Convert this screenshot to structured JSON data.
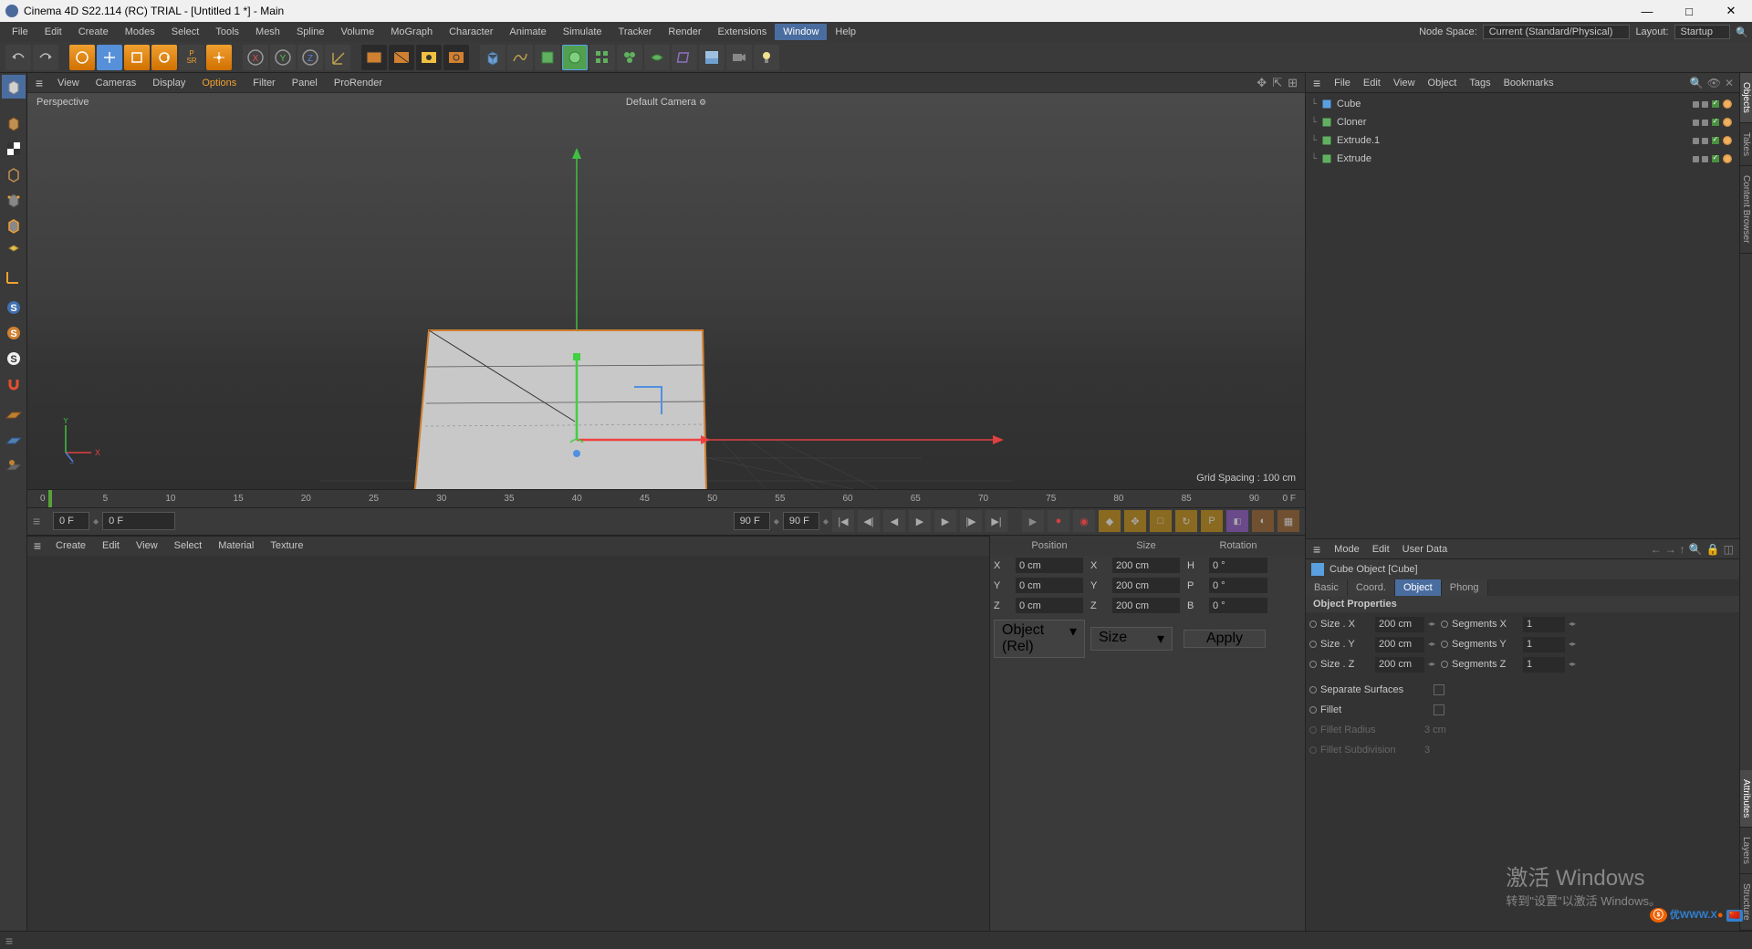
{
  "window": {
    "title": "Cinema 4D S22.114 (RC) TRIAL - [Untitled 1 *] - Main"
  },
  "mainmenu": {
    "items": [
      "File",
      "Edit",
      "Create",
      "Modes",
      "Select",
      "Tools",
      "Mesh",
      "Spline",
      "Volume",
      "MoGraph",
      "Character",
      "Animate",
      "Simulate",
      "Tracker",
      "Render",
      "Extensions",
      "Window",
      "Help"
    ],
    "highlighted": "Window",
    "nodespace_label": "Node Space:",
    "nodespace_value": "Current (Standard/Physical)",
    "layout_label": "Layout:",
    "layout_value": "Startup"
  },
  "viewmenu": {
    "items": [
      "View",
      "Cameras",
      "Display",
      "Options",
      "Filter",
      "Panel",
      "ProRender"
    ],
    "highlighted": "Options"
  },
  "viewport": {
    "label": "Perspective",
    "camera": "Default Camera",
    "grid": "Grid Spacing : 100 cm",
    "axes": {
      "x": "X",
      "y": "Y",
      "z": "Z"
    }
  },
  "timeline": {
    "start": 0,
    "end": 90,
    "ticks": [
      0,
      5,
      10,
      15,
      20,
      25,
      30,
      35,
      40,
      45,
      50,
      55,
      60,
      65,
      70,
      75,
      80,
      85,
      90
    ],
    "unit": "0 F"
  },
  "timecontrols": {
    "frame1": "0 F",
    "frame2": "0 F",
    "frame3": "90 F",
    "frame4": "90 F"
  },
  "matmenu": {
    "items": [
      "Create",
      "Edit",
      "View",
      "Select",
      "Material",
      "Texture"
    ]
  },
  "objmgr": {
    "menu": [
      "File",
      "Edit",
      "View",
      "Object",
      "Tags",
      "Bookmarks"
    ],
    "items": [
      {
        "name": "Cube",
        "icon": "cube",
        "color": "#5aa0e0"
      },
      {
        "name": "Cloner",
        "icon": "cloner",
        "color": "#60b060"
      },
      {
        "name": "Extrude.1",
        "icon": "extrude",
        "color": "#60b060"
      },
      {
        "name": "Extrude",
        "icon": "extrude",
        "color": "#60b060"
      }
    ]
  },
  "attrmgr": {
    "menu": [
      "Mode",
      "Edit",
      "User Data"
    ],
    "title": "Cube Object [Cube]",
    "tabs": [
      "Basic",
      "Coord.",
      "Object",
      "Phong"
    ],
    "selectedTab": "Object",
    "section": "Object Properties",
    "props": {
      "sizeX_label": "Size . X",
      "sizeX": "200 cm",
      "segX_label": "Segments X",
      "segX": "1",
      "sizeY_label": "Size . Y",
      "sizeY": "200 cm",
      "segY_label": "Segments Y",
      "segY": "1",
      "sizeZ_label": "Size . Z",
      "sizeZ": "200 cm",
      "segZ_label": "Segments Z",
      "segZ": "1",
      "sepSurf": "Separate Surfaces",
      "fillet": "Fillet",
      "filletRadius_label": "Fillet Radius",
      "filletRadius": "3 cm",
      "filletSub_label": "Fillet Subdivision",
      "filletSub": "3"
    }
  },
  "coordpanel": {
    "headers": {
      "pos": "Position",
      "size": "Size",
      "rot": "Rotation"
    },
    "rows": {
      "x": {
        "p": "0 cm",
        "s": "200 cm",
        "r": "0 °"
      },
      "y": {
        "p": "0 cm",
        "s": "200 cm",
        "r": "0 °"
      },
      "z": {
        "p": "0 cm",
        "s": "200 cm",
        "r": "0 °"
      }
    },
    "axes": {
      "x": "X",
      "y": "Y",
      "z": "Z",
      "h": "H",
      "p": "P",
      "b": "B"
    },
    "dd1": "Object (Rel)",
    "dd2": "Size",
    "apply": "Apply"
  },
  "sidetabs": {
    "upper": [
      "Objects",
      "Takes",
      "Content Browser"
    ],
    "lower": [
      "Attributes",
      "Layers",
      "Structure"
    ]
  },
  "watermark": {
    "l1": "激活 Windows",
    "l2": "转到\"设置\"以激活 Windows。"
  }
}
